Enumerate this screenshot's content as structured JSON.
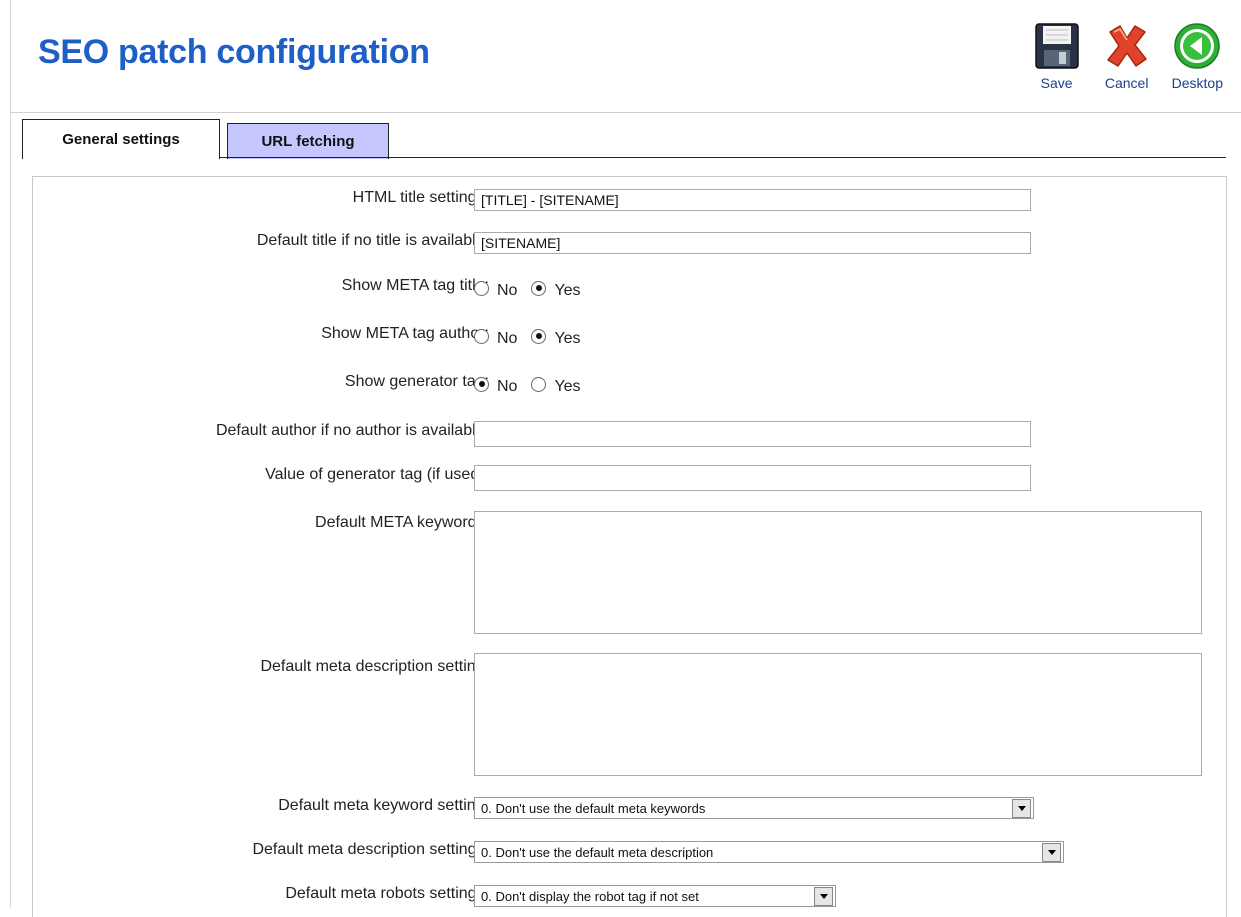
{
  "header": {
    "title": "SEO patch configuration"
  },
  "toolbar": {
    "save_label": "Save",
    "cancel_label": "Cancel",
    "desktop_label": "Desktop"
  },
  "tabs": [
    {
      "label": "General settings",
      "active": true
    },
    {
      "label": "URL fetching",
      "active": false
    }
  ],
  "form": {
    "html_title_label": "HTML title settings:",
    "html_title_value": "[TITLE] - [SITENAME]",
    "default_title_label": "Default title if no title is available:",
    "default_title_value": "[SITENAME]",
    "meta_title_label": "Show META tag title:",
    "meta_title_selected": "Yes",
    "meta_author_label": "Show META tag author:",
    "meta_author_selected": "Yes",
    "generator_label": "Show generator tag:",
    "generator_selected": "No",
    "radio_no": "No",
    "radio_yes": "Yes",
    "default_author_label": "Default author if no author is available:",
    "default_author_value": "",
    "generator_value_label": "Value of generator tag (if used):",
    "generator_value": "",
    "meta_keywords_label": "Default META keywords:",
    "meta_keywords_value": "",
    "meta_description_label": "Default meta description setting:",
    "meta_description_value": "",
    "keyword_setting_label": "Default meta keyword setting:",
    "keyword_setting_value": "0. Don't use the default meta keywords",
    "description_settings_label": "Default meta description settings:",
    "description_settings_value": "0. Don't use the default meta description",
    "robots_settings_label": "Default meta robots settings:",
    "robots_settings_value": "0. Don't display the robot tag if not set"
  },
  "colors": {
    "title": "#1d5fc6",
    "inactive_tab": "#c7c7ff"
  },
  "icons": {
    "save": "floppy-disk-icon",
    "cancel": "red-x-icon",
    "desktop": "green-back-arrow-icon"
  }
}
